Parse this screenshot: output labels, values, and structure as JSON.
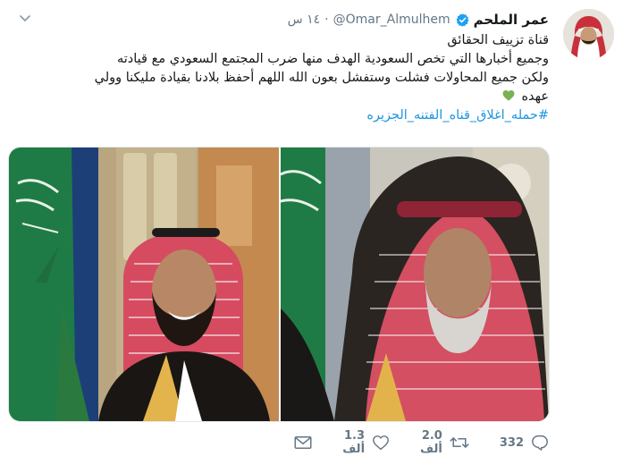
{
  "user": {
    "display_name": "عمر الملحم",
    "handle": "@Omar_Almulhem",
    "time": "١٤ س",
    "verified_icon": "verified-badge-icon",
    "avatar_icon": "avatar"
  },
  "tweet": {
    "line1": "قناة تزييف الحقائق",
    "line2": "وجميع أخبارها التي تخص السعودية الهدف منها ضرب المجتمع السعودي مع قيادته",
    "line3": "ولكن جميع المحاولات فشلت وستفشل بعون الله اللهم أحفظ بلادنا بقيادة مليكنا وولي",
    "line4": "عهده",
    "emoji": "green-heart-icon",
    "hashtag": "#حمله_اغلاق_قناه_الفتنه_الجزيره"
  },
  "actions": {
    "replies": "332",
    "retweets": "2.0 ألف",
    "likes": "1.3 ألف",
    "reply_icon": "reply-icon",
    "retweet_icon": "retweet-icon",
    "like_icon": "heart-icon",
    "dm_icon": "envelope-icon"
  },
  "colors": {
    "text": "#14171a",
    "muted": "#657786",
    "link": "#1b95e0",
    "verified": "#1da1f2"
  }
}
